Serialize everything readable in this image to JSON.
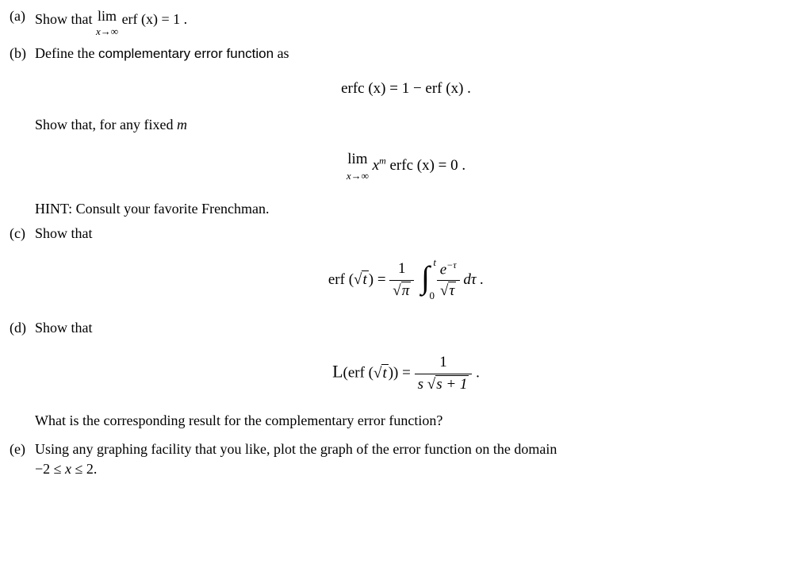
{
  "a": {
    "label": "(a)",
    "prefix": "Show that ",
    "lim": "lim",
    "limsub": "x→∞",
    "expr": " erf (x)  =  1 ."
  },
  "b": {
    "label": "(b)",
    "line1a": "Define the ",
    "line1b": "complementary error function",
    "line1c": " as",
    "eq1": "erfc (x)  =  1  −   erf (x) .",
    "line2a": "Show that, for any fixed ",
    "line2b": "m",
    "eq2_lim": "lim",
    "eq2_limsub": "x→∞",
    "eq2_rest": " x",
    "eq2_sup": "m",
    "eq2_tail": " erfc (x)  =  0 .",
    "hint": "HINT: Consult your favorite Frenchman."
  },
  "c": {
    "label": "(c)",
    "text": "Show that",
    "eq_lhs1": "erf (",
    "eq_sqrt_t": "t",
    "eq_lhs2": ")   =   ",
    "frac1_num": "1",
    "frac1_den_pi": "π",
    "int_upper": "t",
    "int_lower": "0",
    "frac2_num1": "e",
    "frac2_num_sup": "−τ",
    "frac2_den_tau": "τ",
    "eq_tail": " dτ ."
  },
  "d": {
    "label": "(d)",
    "text": "Show that",
    "eq_L": "L",
    "eq_lhs1": "(erf (",
    "eq_sqrt_t": "t",
    "eq_lhs2": "))   =   ",
    "frac_num": "1",
    "frac_den_s": "s ",
    "frac_den_rad": "s + 1",
    "eq_tail": " .",
    "question": "What is the corresponding result for the complementary error function?"
  },
  "e": {
    "label": "(e)",
    "text1": "Using any graphing facility that you like, plot the graph of the error function on the domain",
    "text2a": "−2 ≤ ",
    "text2b": "x",
    "text2c": " ≤ 2."
  }
}
